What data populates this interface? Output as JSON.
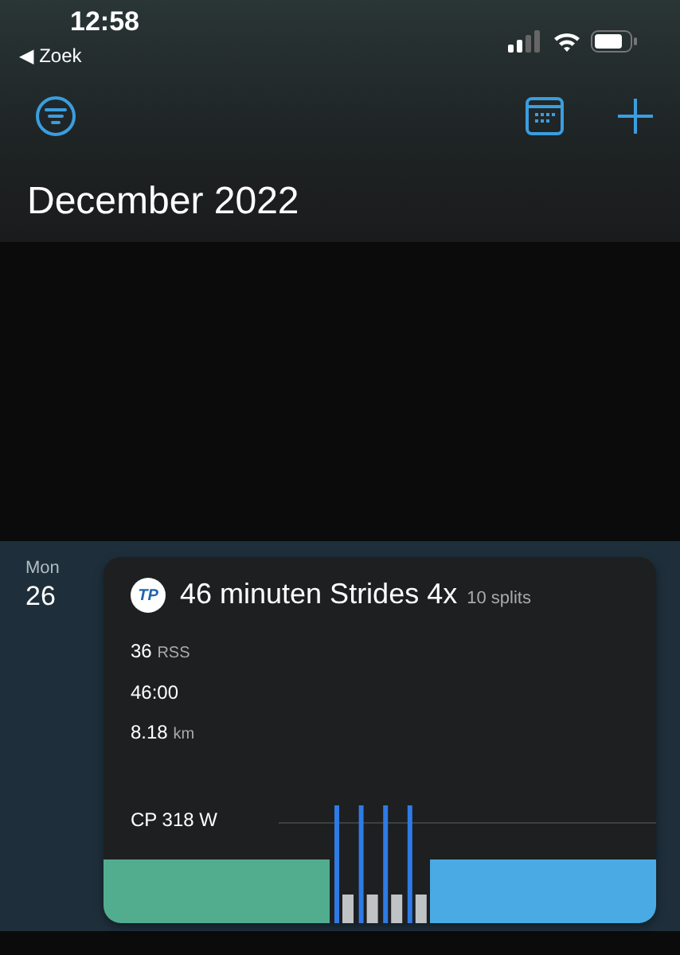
{
  "status_bar": {
    "time": "12:58",
    "back_label": "◀ Zoek"
  },
  "header": {
    "title": "December 2022"
  },
  "days": [
    {
      "weekday": "Mon",
      "date": "26",
      "workouts": [
        {
          "logo_text": "TP",
          "title": "46 minuten Strides 4x",
          "splits": "10 splits",
          "metrics": [
            {
              "value": "36",
              "unit": "RSS"
            },
            {
              "value": "46:00"
            },
            {
              "value": "8.18",
              "unit": "km"
            }
          ],
          "cp_label": "CP 318 W"
        }
      ]
    }
  ]
}
